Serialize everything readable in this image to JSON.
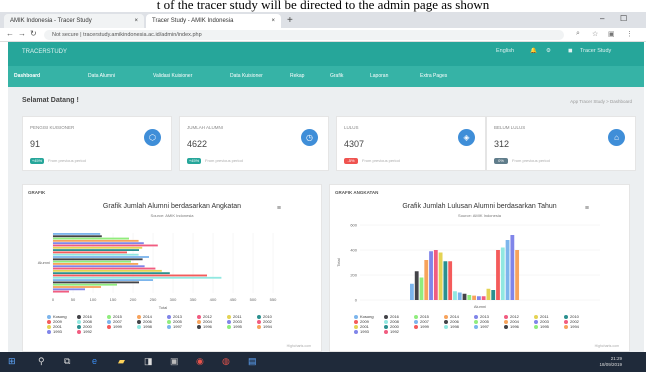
{
  "caption": "t of the tracer study will be directed to the admin page as shown",
  "browser": {
    "tabs": [
      {
        "label": "AMIK Indonesia - Tracer Study"
      },
      {
        "label": "Tracer Study - AMIK Indonesia"
      }
    ],
    "new_tab": "+",
    "url": "tracerstudy.amikindonesia.ac.id/admin/index.php",
    "security": "Not secure"
  },
  "app": {
    "brand": "TRACERSTUDY",
    "language": "English",
    "user": "Tracer Study",
    "menu": [
      {
        "label": "Dashboard",
        "active": true
      },
      {
        "label": "Data Alumni"
      },
      {
        "label": "Validasi Kuisioner"
      },
      {
        "label": "Data Kuisioner"
      },
      {
        "label": "Rekap"
      },
      {
        "label": "Grafik"
      },
      {
        "label": "Laporan"
      },
      {
        "label": "Extra Pages"
      }
    ],
    "page_title": "Selamat Datang !",
    "breadcrumb": "App Tracer Study > Dashboard"
  },
  "cards": [
    {
      "label": "PENGISI KUISIONER",
      "value": "91",
      "badge": "+45%",
      "from": "From previous period",
      "color": "#26a69a"
    },
    {
      "label": "JUMLAH ALUMNI",
      "value": "4622",
      "badge": "+45%",
      "from": "From previous period",
      "color": "#26a69a"
    },
    {
      "label": "LULUS",
      "value": "4307",
      "badge": "-5%",
      "from": "From previous period",
      "color": "#ef5350"
    },
    {
      "label": "BELUM LULUS",
      "value": "312",
      "badge": "0%",
      "from": "From previous period",
      "color": "#607d8b"
    }
  ],
  "chart_data": [
    {
      "type": "bar",
      "panel_title": "GRAFIK",
      "title": "Grafik Jumlah Alumni berdasarkan Angkatan",
      "subtitle": "Source: AMIK Indonesia",
      "xlabel": "Total",
      "categories": [
        "Alumni"
      ],
      "xlim": [
        0,
        550
      ],
      "ticks": [
        "0",
        "50",
        "100",
        "150",
        "200",
        "250",
        "300",
        "350",
        "400",
        "450",
        "500",
        "550"
      ],
      "series": [
        {
          "name": "Kosong",
          "value": 118,
          "color": "#7cb5ec"
        },
        {
          "name": "2016",
          "value": 122,
          "color": "#434348"
        },
        {
          "name": "2015",
          "value": 190,
          "color": "#90ed7d"
        },
        {
          "name": "2014",
          "value": 214,
          "color": "#f7a35c"
        },
        {
          "name": "2013",
          "value": 227,
          "color": "#8085e9"
        },
        {
          "name": "2012",
          "value": 262,
          "color": "#f15c80"
        },
        {
          "name": "2011",
          "value": 223,
          "color": "#e4d354"
        },
        {
          "name": "2010",
          "value": 215,
          "color": "#2b908f"
        },
        {
          "name": "2009",
          "value": 185,
          "color": "#f45b5b"
        },
        {
          "name": "2008",
          "value": 214,
          "color": "#91e8e1"
        },
        {
          "name": "2007",
          "value": 240,
          "color": "#7cb5ec"
        },
        {
          "name": "2006",
          "value": 224,
          "color": "#434348"
        },
        {
          "name": "2005",
          "value": 195,
          "color": "#90ed7d"
        },
        {
          "name": "2004",
          "value": 213,
          "color": "#f7a35c"
        },
        {
          "name": "2003",
          "value": 229,
          "color": "#8085e9"
        },
        {
          "name": "2002",
          "value": 256,
          "color": "#f15c80"
        },
        {
          "name": "2001",
          "value": 272,
          "color": "#e4d354"
        },
        {
          "name": "2000",
          "value": 292,
          "color": "#2b908f"
        },
        {
          "name": "1999",
          "value": 385,
          "color": "#f45b5b"
        },
        {
          "name": "1998",
          "value": 421,
          "color": "#91e8e1"
        },
        {
          "name": "1997",
          "value": 250,
          "color": "#7cb5ec"
        },
        {
          "name": "1996",
          "value": 215,
          "color": "#434348"
        },
        {
          "name": "1995",
          "value": 160,
          "color": "#90ed7d"
        },
        {
          "name": "1994",
          "value": 120,
          "color": "#f7a35c"
        },
        {
          "name": "1993",
          "value": 80,
          "color": "#8085e9"
        },
        {
          "name": "1992",
          "value": 40,
          "color": "#f15c80"
        }
      ]
    },
    {
      "type": "bar",
      "panel_title": "GRAFIK ANGKATAN",
      "title": "Grafik Jumlah Lulusan Alumni berdasarkan Tahun",
      "subtitle": "Source: AMIK Indonesia",
      "ylabel": "Total",
      "xlabel": "Alumni",
      "ylim": [
        0,
        600
      ],
      "ticks": [
        "0",
        "200",
        "400",
        "600"
      ],
      "series": [
        {
          "name": "Kosong",
          "value": 130,
          "color": "#7cb5ec"
        },
        {
          "name": "2016",
          "value": 230,
          "color": "#434348"
        },
        {
          "name": "2015",
          "value": 180,
          "color": "#90ed7d"
        },
        {
          "name": "2014",
          "value": 320,
          "color": "#f7a35c"
        },
        {
          "name": "2013",
          "value": 390,
          "color": "#8085e9"
        },
        {
          "name": "2012",
          "value": 400,
          "color": "#f15c80"
        },
        {
          "name": "2011",
          "value": 380,
          "color": "#e4d354"
        },
        {
          "name": "2010",
          "value": 310,
          "color": "#2b908f"
        },
        {
          "name": "2009",
          "value": 310,
          "color": "#f45b5b"
        },
        {
          "name": "2008",
          "value": 70,
          "color": "#91e8e1"
        },
        {
          "name": "2007",
          "value": 60,
          "color": "#7cb5ec"
        },
        {
          "name": "2006",
          "value": 50,
          "color": "#434348"
        },
        {
          "name": "2005",
          "value": 40,
          "color": "#90ed7d"
        },
        {
          "name": "2004",
          "value": 35,
          "color": "#f7a35c"
        },
        {
          "name": "2003",
          "value": 30,
          "color": "#8085e9"
        },
        {
          "name": "2002",
          "value": 30,
          "color": "#f15c80"
        },
        {
          "name": "2001",
          "value": 90,
          "color": "#e4d354"
        },
        {
          "name": "2000",
          "value": 80,
          "color": "#2b908f"
        },
        {
          "name": "1999",
          "value": 400,
          "color": "#f45b5b"
        },
        {
          "name": "1998",
          "value": 420,
          "color": "#91e8e1"
        },
        {
          "name": "1997",
          "value": 480,
          "color": "#7cb5ec"
        },
        {
          "name": "1996",
          "value": 520,
          "color": "#8085e9"
        },
        {
          "name": "1995",
          "value": 400,
          "color": "#f7a35c"
        }
      ]
    }
  ],
  "legend": [
    "Kosong",
    "2016",
    "2015",
    "2014",
    "2013",
    "2012",
    "2011",
    "2010",
    "2009",
    "2008",
    "2007",
    "2006",
    "2005",
    "2004",
    "2003",
    "2002",
    "2001",
    "2000",
    "1999",
    "1998",
    "1997",
    "1996",
    "1995",
    "1994",
    "1993",
    "1992"
  ],
  "credit": "Highcharts.com",
  "taskbar": {
    "time": "21:29",
    "date": "18/09/2019"
  }
}
